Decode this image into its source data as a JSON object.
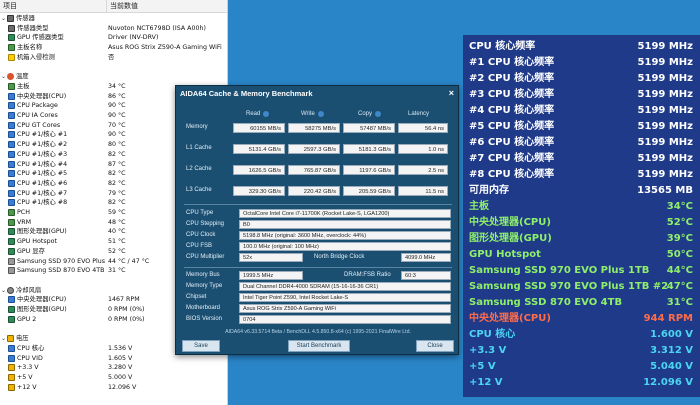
{
  "sensor_panel": {
    "col_item": "项目",
    "col_value": "当前数值",
    "rows": [
      {
        "label": "传感器",
        "value": "",
        "icon": "sensor-icon",
        "cat": true
      },
      {
        "label": "传感器类型",
        "value": "Nuvoton NCT6798D  (ISA A00h)",
        "icon": "sensor-icon"
      },
      {
        "label": "GPU 传感器类型",
        "value": "Driver  (NV-DRV)",
        "icon": "gpu-icon"
      },
      {
        "label": "主板名称",
        "value": "Asus ROG Strix Z590-A Gaming WiFi",
        "icon": "mb-icon"
      },
      {
        "label": "机箱入侵检测",
        "value": "否",
        "icon": "warn-icon"
      },
      {
        "label": "",
        "value": "",
        "icon": ""
      },
      {
        "label": "温度",
        "value": "",
        "icon": "temp-icon",
        "cat": true
      },
      {
        "label": "主板",
        "value": "34 °C",
        "icon": "mb-icon"
      },
      {
        "label": "中央处理器(CPU)",
        "value": "86 °C",
        "icon": "cpu-icon"
      },
      {
        "label": "CPU Package",
        "value": "90 °C",
        "icon": "cpu-icon"
      },
      {
        "label": "CPU IA Cores",
        "value": "90 °C",
        "icon": "cpu-icon"
      },
      {
        "label": "CPU GT Cores",
        "value": "70 °C",
        "icon": "cpu-icon"
      },
      {
        "label": "CPU #1/核心 #1",
        "value": "90 °C",
        "icon": "cpu-icon"
      },
      {
        "label": "CPU #1/核心 #2",
        "value": "80 °C",
        "icon": "cpu-icon"
      },
      {
        "label": "CPU #1/核心 #3",
        "value": "82 °C",
        "icon": "cpu-icon"
      },
      {
        "label": "CPU #1/核心 #4",
        "value": "87 °C",
        "icon": "cpu-icon"
      },
      {
        "label": "CPU #1/核心 #5",
        "value": "82 °C",
        "icon": "cpu-icon"
      },
      {
        "label": "CPU #1/核心 #6",
        "value": "82 °C",
        "icon": "cpu-icon"
      },
      {
        "label": "CPU #1/核心 #7",
        "value": "79 °C",
        "icon": "cpu-icon"
      },
      {
        "label": "CPU #1/核心 #8",
        "value": "82 °C",
        "icon": "cpu-icon"
      },
      {
        "label": "PCH",
        "value": "59 °C",
        "icon": "mb-icon"
      },
      {
        "label": "VRM",
        "value": "48 °C",
        "icon": "mb-icon"
      },
      {
        "label": "图形处理器(GPU)",
        "value": "40 °C",
        "icon": "gpu-icon"
      },
      {
        "label": "GPU Hotspot",
        "value": "51 °C",
        "icon": "gpu-icon"
      },
      {
        "label": "GPU 显存",
        "value": "52 °C",
        "icon": "gpu-icon"
      },
      {
        "label": "Samsung SSD 970 EVO Plus ...",
        "value": "44 °C / 47 °C",
        "icon": "disk-icon"
      },
      {
        "label": "Samsung SSD 870 EVO 4TB",
        "value": "31 °C",
        "icon": "disk-icon"
      },
      {
        "label": "",
        "value": "",
        "icon": ""
      },
      {
        "label": "冷却风扇",
        "value": "",
        "icon": "fan-icon",
        "cat": true
      },
      {
        "label": "中央处理器(CPU)",
        "value": "1467 RPM",
        "icon": "cpu-icon"
      },
      {
        "label": "图形处理器(GPU)",
        "value": "0 RPM  (0%)",
        "icon": "gpu-icon"
      },
      {
        "label": "GPU 2",
        "value": "0 RPM  (0%)",
        "icon": "gpu-icon"
      },
      {
        "label": "",
        "value": "",
        "icon": ""
      },
      {
        "label": "电压",
        "value": "",
        "icon": "volt-icon",
        "cat": true
      },
      {
        "label": "CPU 核心",
        "value": "1.536 V",
        "icon": "cpu-icon"
      },
      {
        "label": "CPU VID",
        "value": "1.605 V",
        "icon": "cpu-icon"
      },
      {
        "label": "+3.3 V",
        "value": "3.280 V",
        "icon": "volt-icon"
      },
      {
        "label": "+5 V",
        "value": "5.000 V",
        "icon": "volt-icon"
      },
      {
        "label": "+12 V",
        "value": "12.096 V",
        "icon": "volt-icon"
      }
    ]
  },
  "bench": {
    "title": "AIDA64 Cache & Memory Benchmark",
    "close_glyph": "×",
    "headers": {
      "read": "Read",
      "write": "Write",
      "copy": "Copy",
      "latency": "Latency"
    },
    "rows": [
      {
        "label": "Memory",
        "read": "60155 MB/s",
        "write": "58275 MB/s",
        "copy": "57487 MB/s",
        "latency": "56.4 ns"
      },
      {
        "label": "L1 Cache",
        "read": "5131.4 GB/s",
        "write": "2597.3 GB/s",
        "copy": "5181.3 GB/s",
        "latency": "1.0 ns"
      },
      {
        "label": "L2 Cache",
        "read": "1626.5 GB/s",
        "write": "765.87 GB/s",
        "copy": "1197.6 GB/s",
        "latency": "2.5 ns"
      },
      {
        "label": "L3 Cache",
        "read": "329.30 GB/s",
        "write": "220.42 GB/s",
        "copy": "205.59 GB/s",
        "latency": "11.5 ns"
      }
    ],
    "info": {
      "cpu_type_label": "CPU Type",
      "cpu_type": "OctalCore Intel Core i7-11700K  (Rocket Lake-S, LGA1200)",
      "cpu_stepping_label": "CPU Stepping",
      "cpu_stepping": "B0",
      "cpu_clock_label": "CPU Clock",
      "cpu_clock": "5198.8 MHz  (original: 3600 MHz, overclock: 44%)",
      "cpu_fsb_label": "CPU FSB",
      "cpu_fsb": "100.0 MHz  (original: 100 MHz)",
      "cpu_mult_label": "CPU Multiplier",
      "cpu_mult": "52x",
      "nb_clock_label": "North Bridge Clock",
      "nb_clock": "4099.0 MHz",
      "mem_bus_label": "Memory Bus",
      "mem_bus": "1999.5 MHz",
      "dram_ratio_label": "DRAM:FSB Ratio",
      "dram_ratio": "60:3",
      "mem_type_label": "Memory Type",
      "mem_type": "Dual Channel DDR4-4000 SDRAM  (15-16-16-36 CR1)",
      "chipset_label": "Chipset",
      "chipset": "Intel Tiger Point Z590, Intel Rocket Lake-S",
      "mobo_label": "Motherboard",
      "mobo": "Asus ROG Strix Z590-A Gaming WiFi",
      "bios_label": "BIOS Version",
      "bios": "0704"
    },
    "footer": "AIDA64 v6.33.5714 Beta / BenchDLL 4.5.850.8-x64  (c) 1995-2021 FinalWire Ltd.",
    "buttons": {
      "save": "Save",
      "start": "Start Benchmark",
      "close": "Close"
    }
  },
  "osd": {
    "rows": [
      {
        "label": "CPU 核心频率",
        "value": "5199 MHz",
        "color": "white"
      },
      {
        "label": "#1 CPU 核心频率",
        "value": "5199 MHz",
        "color": "white"
      },
      {
        "label": "#2 CPU 核心频率",
        "value": "5199 MHz",
        "color": "white"
      },
      {
        "label": "#3 CPU 核心频率",
        "value": "5199 MHz",
        "color": "white"
      },
      {
        "label": "#4 CPU 核心频率",
        "value": "5199 MHz",
        "color": "white"
      },
      {
        "label": "#5 CPU 核心频率",
        "value": "5199 MHz",
        "color": "white"
      },
      {
        "label": "#6 CPU 核心频率",
        "value": "5199 MHz",
        "color": "white"
      },
      {
        "label": "#7 CPU 核心频率",
        "value": "5199 MHz",
        "color": "white"
      },
      {
        "label": "#8 CPU 核心频率",
        "value": "5199 MHz",
        "color": "white"
      },
      {
        "label": "可用内存",
        "value": "13565 MB",
        "color": "white"
      },
      {
        "label": "主板",
        "value": "34°C",
        "color": "green"
      },
      {
        "label": "中央处理器(CPU)",
        "value": "52°C",
        "color": "green"
      },
      {
        "label": "图形处理器(GPU)",
        "value": "39°C",
        "color": "green"
      },
      {
        "label": "GPU Hotspot",
        "value": "50°C",
        "color": "green"
      },
      {
        "label": "Samsung SSD 970 EVO Plus 1TB",
        "value": "44°C",
        "color": "green"
      },
      {
        "label": "Samsung SSD 970 EVO Plus 1TB #2",
        "value": "47°C",
        "color": "green"
      },
      {
        "label": "Samsung SSD 870 EVO 4TB",
        "value": "31°C",
        "color": "green"
      },
      {
        "label": "中央处理器(CPU)",
        "value": "944 RPM",
        "color": "red"
      },
      {
        "label": "CPU 核心",
        "value": "1.600 V",
        "color": "cyan"
      },
      {
        "label": "+3.3 V",
        "value": "3.312 V",
        "color": "cyan"
      },
      {
        "label": "+5 V",
        "value": "5.040 V",
        "color": "cyan"
      },
      {
        "label": "+12 V",
        "value": "12.096 V",
        "color": "cyan"
      }
    ]
  },
  "colors": {
    "desktop": "#2a85c8",
    "osd_bg": "#203a8a",
    "osd_white": "#ffffff",
    "osd_green": "#8ef06a",
    "osd_cyan": "#4ad6f2",
    "osd_red": "#ff6c4a",
    "bench_bg": "#1a4f72"
  }
}
